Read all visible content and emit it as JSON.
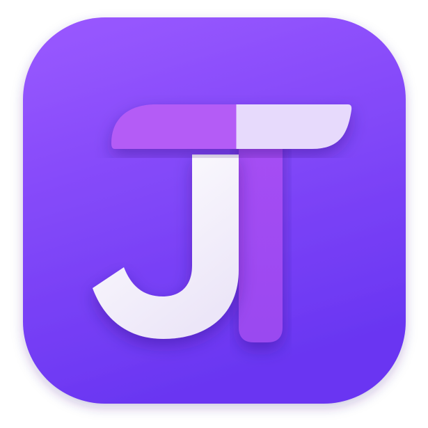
{
  "icon": {
    "name": "app-icon",
    "logo_text": "JT",
    "monogram_icon": "jt-monogram-icon"
  },
  "colors": {
    "background_top": "#9a59ff",
    "background_bottom": "#6a36f2",
    "t_bar_left": "#b45cf6",
    "t_bar_right": "#e7dafc",
    "t_stem_top": "#a64ef4",
    "t_stem_bottom": "#9a48f0",
    "j_light": "#ffffff",
    "j_shade": "#ece6f8"
  }
}
